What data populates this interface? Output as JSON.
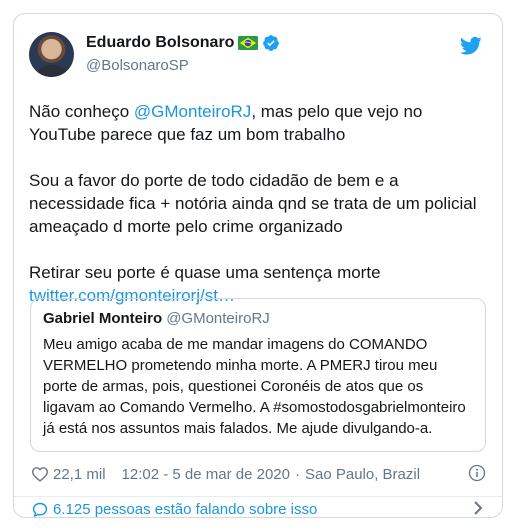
{
  "tweet": {
    "author": {
      "name": "Eduardo Bolsonaro",
      "handle": "@BolsonaroSP"
    },
    "body": {
      "p1_before": "Não conheço ",
      "p1_mention": "@GMonteiroRJ",
      "p1_after": ", mas pelo que vejo no YouTube parece que faz um bom trabalho",
      "p2": "Sou a favor do porte de todo cidadão de bem e a necessidade fica + notória ainda qnd se trata de um policial ameaçado d morte pelo crime organizado",
      "p3": "Retirar seu porte é quase uma sentença morte",
      "link": "twitter.com/gmonteirorj/st…"
    },
    "quoted": {
      "name": "Gabriel Monteiro",
      "handle": "@GMonteiroRJ",
      "text": "Meu amigo acaba de me mandar imagens do COMANDO VERMELHO prometendo minha morte. A PMERJ tirou meu porte de armas, pois, questionei Coronéis de atos que os ligavam ao Comando Vermelho. A #somostodosgabrielmonteiro já está nos assuntos mais falados. Me ajude divulgando-a."
    },
    "meta": {
      "likes": "22,1 mil",
      "time": "12:02 - 5 de mar de 2020",
      "separator": "·",
      "location": "Sao Paulo, Brazil"
    },
    "footer": {
      "conversation": "6.125 pessoas estão falando sobre isso"
    }
  },
  "colors": {
    "accent": "#1b95e0",
    "text": "#14171a",
    "secondary": "#657786",
    "border": "#cfd9de",
    "verified": "#1da1f2"
  },
  "icons": {
    "flag": "brazil-flag-icon",
    "verified": "verified-badge-icon",
    "logo": "twitter-bird-icon",
    "like": "heart-icon",
    "info": "info-icon",
    "reply": "chat-bubble-icon",
    "more": "chevron-right-icon"
  }
}
